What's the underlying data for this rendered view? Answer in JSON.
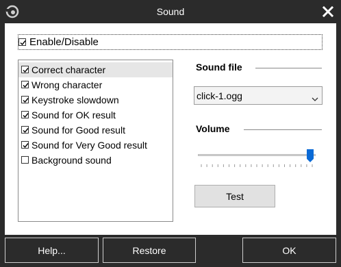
{
  "window": {
    "title": "Sound",
    "icon": "app-logo-icon",
    "close_icon": "close-icon"
  },
  "enable": {
    "label": "Enable/Disable",
    "checked": true
  },
  "sound_list": {
    "items": [
      {
        "label": "Correct character",
        "checked": true,
        "selected": true
      },
      {
        "label": "Wrong character",
        "checked": true,
        "selected": false
      },
      {
        "label": "Keystroke slowdown",
        "checked": true,
        "selected": false
      },
      {
        "label": "Sound for OK result",
        "checked": true,
        "selected": false
      },
      {
        "label": "Sound for Good result",
        "checked": true,
        "selected": false
      },
      {
        "label": "Sound for Very Good result",
        "checked": true,
        "selected": false
      },
      {
        "label": "Background sound",
        "checked": false,
        "selected": false
      }
    ]
  },
  "sound_file": {
    "label": "Sound file",
    "value": "click-1.ogg"
  },
  "volume": {
    "label": "Volume",
    "level_fraction": 0.98
  },
  "buttons": {
    "test": "Test",
    "help": "Help...",
    "restore": "Restore",
    "ok": "OK"
  },
  "colors": {
    "thumb": "#0a6ad6",
    "background": "#2b2b2b"
  }
}
